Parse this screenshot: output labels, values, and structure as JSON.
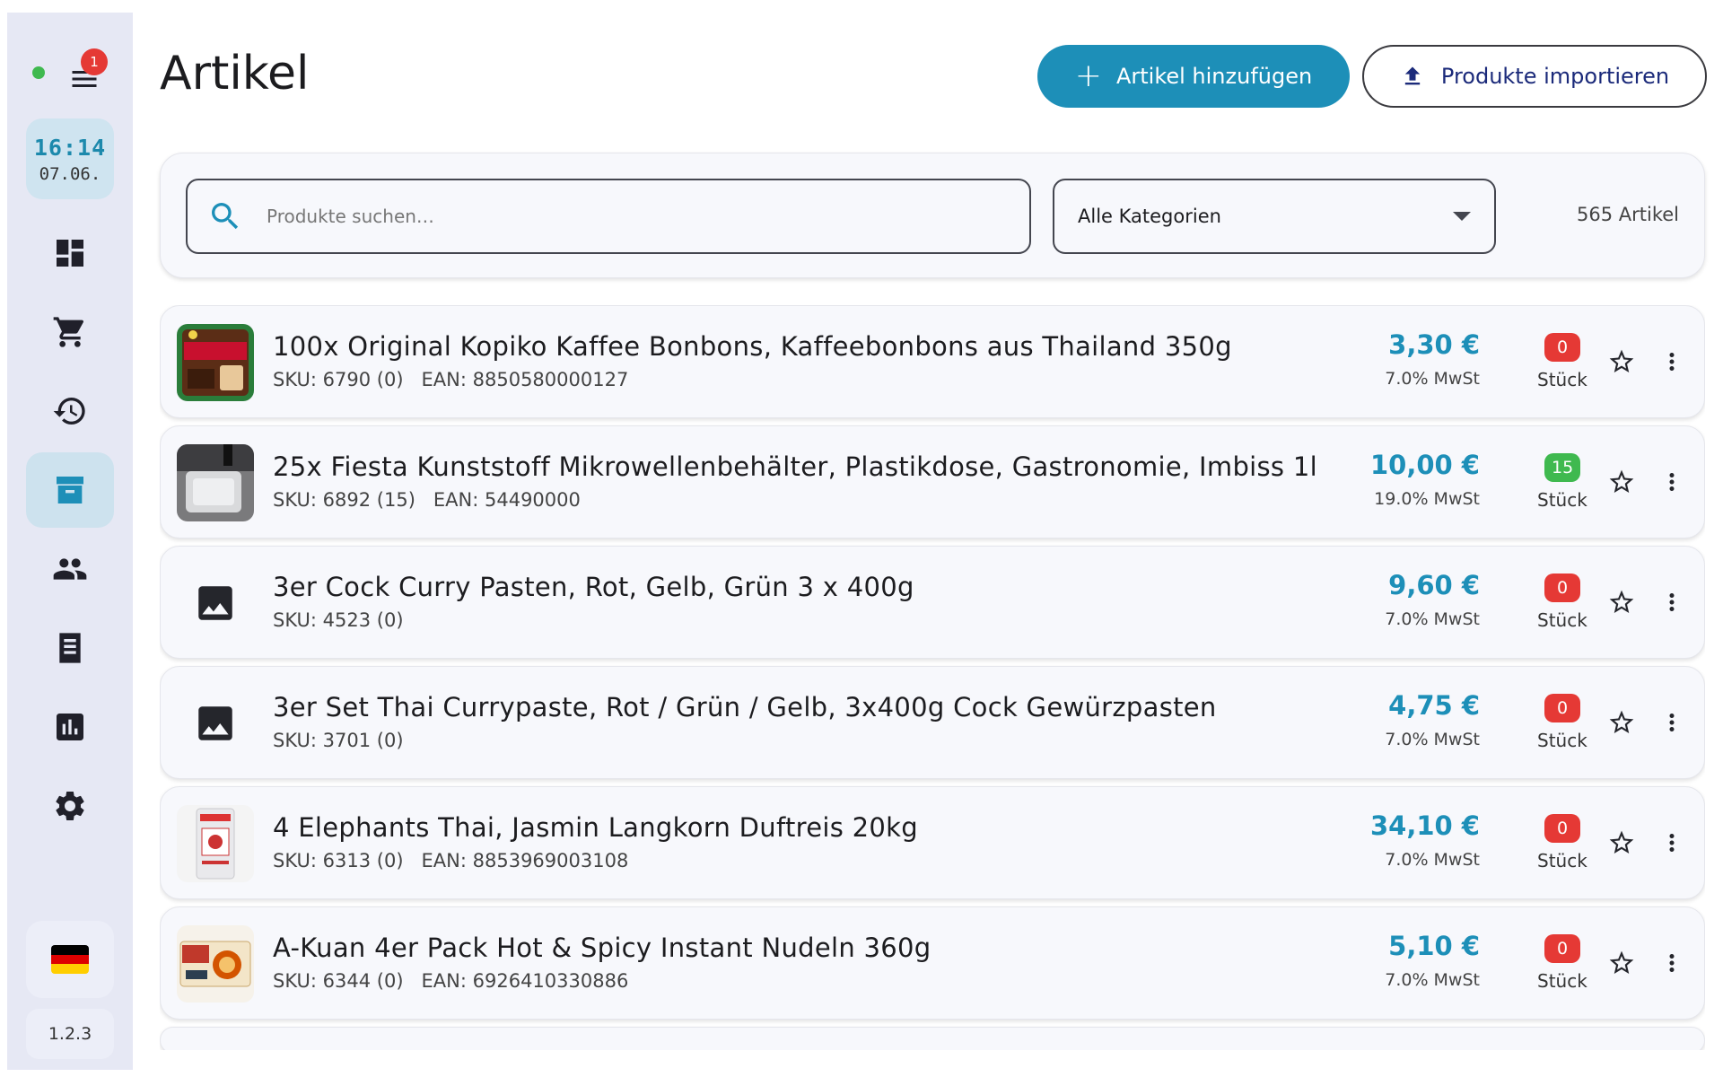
{
  "sidebar": {
    "notification_count": "1",
    "clock_time": "16:14",
    "clock_date": "07.06.",
    "nav_items": [
      {
        "icon": "dashboard-icon"
      },
      {
        "icon": "cart-icon"
      },
      {
        "icon": "history-icon"
      },
      {
        "icon": "archive-icon",
        "active": true
      },
      {
        "icon": "people-icon"
      },
      {
        "icon": "receipt-icon"
      },
      {
        "icon": "bar-chart-icon"
      },
      {
        "icon": "settings-icon"
      }
    ],
    "language_flag": "german-flag-icon",
    "version": "1.2.3"
  },
  "header": {
    "title": "Artikel",
    "add_button": "Artikel hinzufügen",
    "import_button": "Produkte importieren"
  },
  "filters": {
    "search_placeholder": "Produkte suchen…",
    "search_value": "",
    "category": "Alle Kategorien",
    "count": "565 Artikel"
  },
  "colors": {
    "accent": "#1d8fb8",
    "stock_zero": "#e53935",
    "stock_positive": "#3fb94f"
  },
  "products": [
    {
      "name": "100x Original Kopiko Kaffee Bonbons, Kaffeebonbons aus Thailand 350g",
      "sku": "SKU: 6790 (0)",
      "ean": "EAN: 8850580000127",
      "price": "3,30 €",
      "vat": "7.0% MwSt",
      "stock": "0",
      "unit": "Stück",
      "image": "kopiko-product-image"
    },
    {
      "name": "25x Fiesta Kunststoff Mikrowellenbehälter, Plastikdose, Gastronomie, Imbiss 1l",
      "sku": "SKU: 6892 (15)",
      "ean": "EAN: 54490000",
      "price": "10,00 €",
      "vat": "19.0% MwSt",
      "stock": "15",
      "unit": "Stück",
      "image": "plastic-container-product-image"
    },
    {
      "name": "3er Cock Curry Pasten, Rot, Gelb, Grün 3 x 400g",
      "sku": "SKU: 4523 (0)",
      "ean": "",
      "price": "9,60 €",
      "vat": "7.0% MwSt",
      "stock": "0",
      "unit": "Stück",
      "image": "image-placeholder-icon"
    },
    {
      "name": "3er Set Thai Currypaste, Rot / Grün / Gelb, 3x400g Cock Gewürzpasten",
      "sku": "SKU: 3701 (0)",
      "ean": "",
      "price": "4,75 €",
      "vat": "7.0% MwSt",
      "stock": "0",
      "unit": "Stück",
      "image": "image-placeholder-icon"
    },
    {
      "name": "4 Elephants Thai, Jasmin Langkorn Duftreis 20kg",
      "sku": "SKU: 6313 (0)",
      "ean": "EAN: 8853969003108",
      "price": "34,10 €",
      "vat": "7.0% MwSt",
      "stock": "0",
      "unit": "Stück",
      "image": "rice-bag-product-image"
    },
    {
      "name": "A-Kuan 4er Pack Hot & Spicy Instant Nudeln 360g",
      "sku": "SKU: 6344 (0)",
      "ean": "EAN: 6926410330886",
      "price": "5,10 €",
      "vat": "7.0% MwSt",
      "stock": "0",
      "unit": "Stück",
      "image": "noodles-product-image"
    }
  ]
}
